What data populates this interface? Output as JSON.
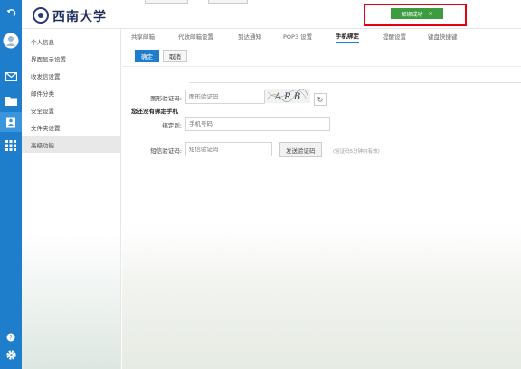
{
  "header": {
    "logo_text": "西南大学",
    "toast": {
      "text": "解绑成功",
      "close": "×",
      "color": "#3d9c3f"
    }
  },
  "rail": {
    "icons": [
      "back-icon",
      "avatar-icon",
      "mail-icon",
      "folder-icon",
      "contacts-icon",
      "apps-grid-icon",
      "help-icon",
      "settings-gear-icon"
    ],
    "accent": "#1f7ecb"
  },
  "sidenav": {
    "items": [
      {
        "label": "个人信息"
      },
      {
        "label": "界面显示设置"
      },
      {
        "label": "收发信设置"
      },
      {
        "label": "邮件分类"
      },
      {
        "label": "安全设置"
      },
      {
        "label": "文件夹设置"
      },
      {
        "label": "高级功能"
      }
    ],
    "selected": "高级功能"
  },
  "tabs": [
    {
      "label": "共享邮箱"
    },
    {
      "label": "代收邮箱设置"
    },
    {
      "label": "到达通知"
    },
    {
      "label": "POP3 设置"
    },
    {
      "label": "手机绑定"
    },
    {
      "label": "提醒设置"
    },
    {
      "label": "键盘快捷键"
    }
  ],
  "active_tab": "手机绑定",
  "actions": {
    "confirm": "确定",
    "cancel": "取消"
  },
  "section": {
    "title": "您还没有绑定手机"
  },
  "form": {
    "captcha_label": "图形验证码:",
    "captcha_placeholder": "图形验证码",
    "captcha_image_text": "A R B",
    "bind_label": "绑定到:",
    "phone_placeholder": "手机号码",
    "sms_label": "短信验证码:",
    "sms_placeholder": "短信验证码",
    "send_button": "发送验证码",
    "hint": "(验证码5分钟内有效)"
  }
}
